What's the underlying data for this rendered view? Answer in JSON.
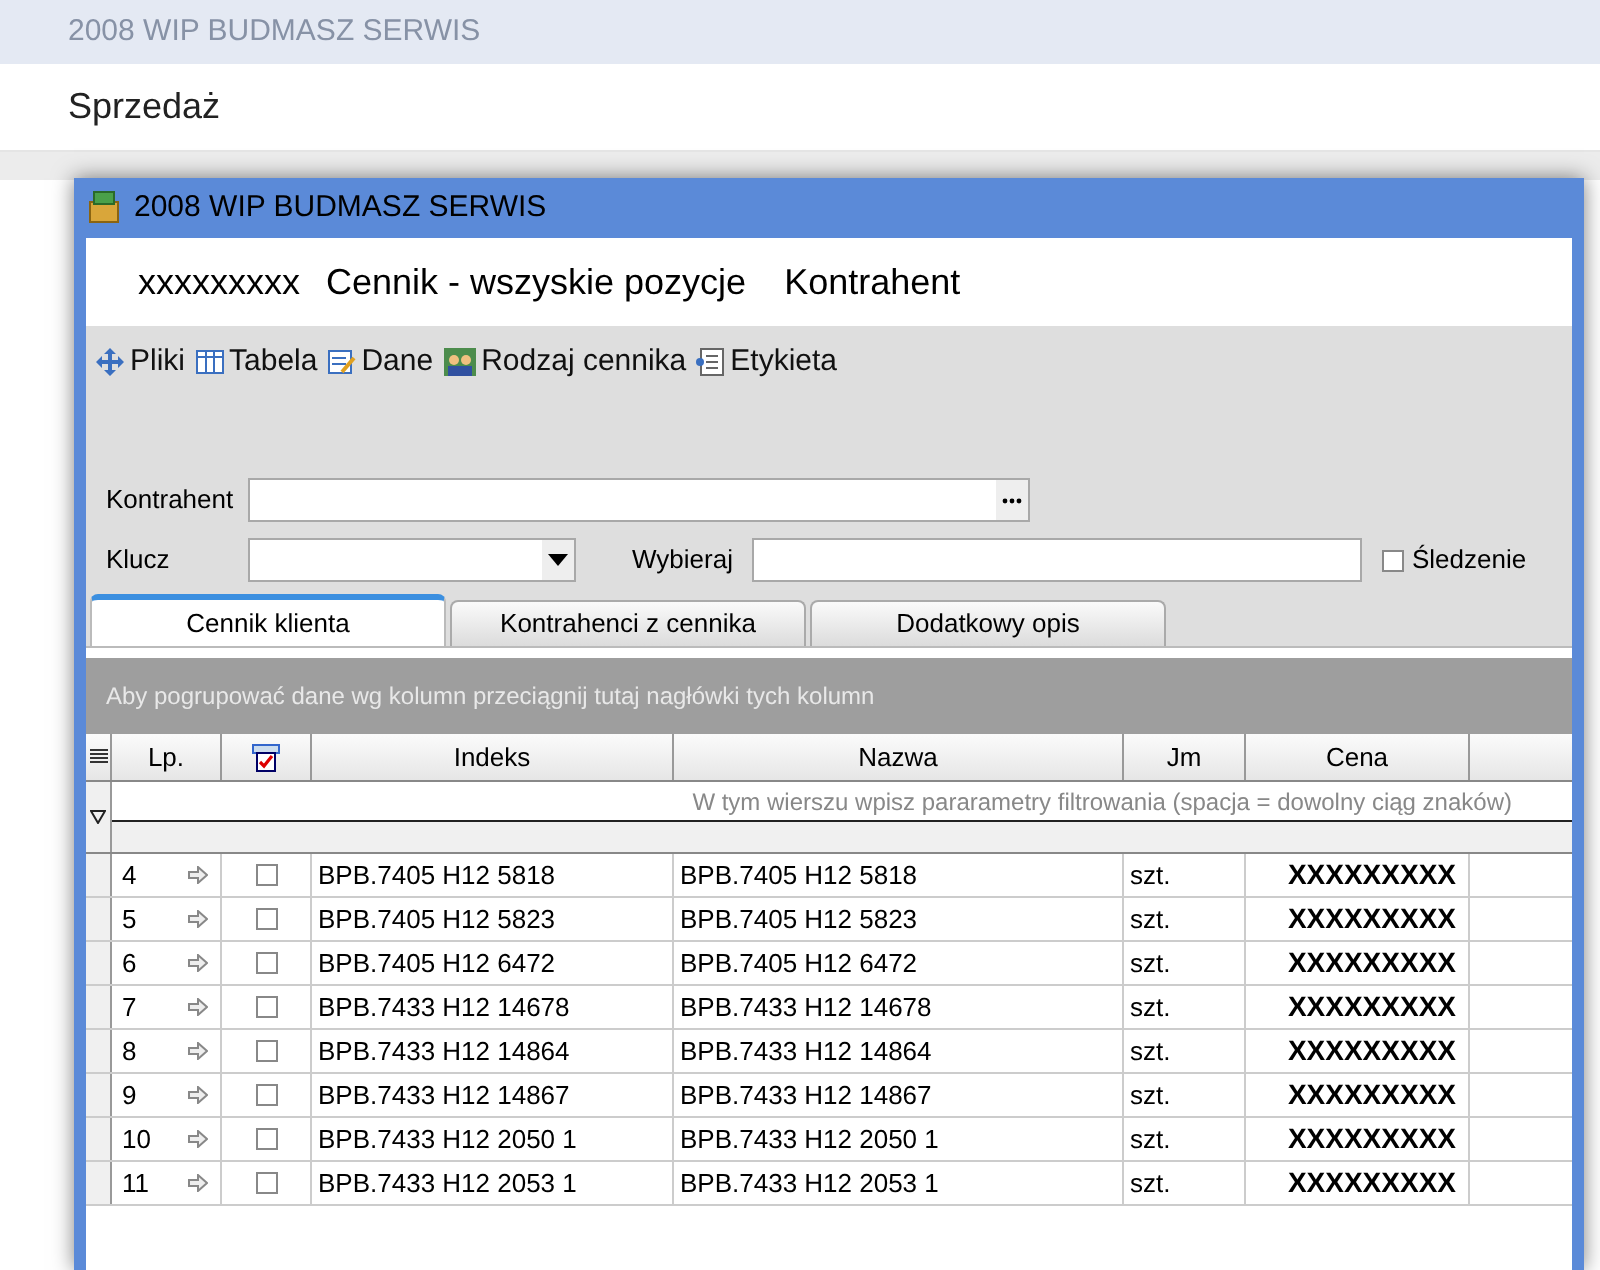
{
  "background_window": {
    "title": "2008 WIP BUDMASZ SERWIS",
    "section": "Sprzedaż"
  },
  "window": {
    "title": "2008 WIP BUDMASZ SERWIS"
  },
  "header": {
    "code": "xxxxxxxxx",
    "title": "Cennik - wszyskie pozycje",
    "subtitle": "Kontrahent"
  },
  "toolbar": [
    {
      "label": "Pliki",
      "kind": "files"
    },
    {
      "label": "Tabela",
      "kind": "table"
    },
    {
      "label": "Dane",
      "kind": "data"
    },
    {
      "label": "Rodzaj cennika",
      "kind": "people"
    },
    {
      "label": "Etykieta",
      "kind": "label"
    }
  ],
  "filters": {
    "kontrahent_label": "Kontrahent",
    "klucz_label": "Klucz",
    "wybieraj_label": "Wybieraj",
    "tracking": {
      "label": "Śledzenie",
      "checked": false
    }
  },
  "tabs": [
    {
      "label": "Cennik klienta",
      "selected": true
    },
    {
      "label": "Kontrahenci z cennika",
      "selected": false
    },
    {
      "label": "Dodatkowy opis",
      "selected": false
    }
  ],
  "group_panel": "Aby pogrupować dane wg kolumn przeciągnij tutaj nagłówki tych kolumn",
  "table": {
    "columns": [
      "Lp.",
      "Indeks",
      "Nazwa",
      "Jm",
      "Cena"
    ],
    "filter_hint": "W tym wierszu wpisz pararametry filtrowania (spacja = dowolny ciąg znaków)",
    "rows": [
      {
        "lp": "4",
        "checked": false,
        "indeks": "BPB.7405 H12 5818",
        "nazwa": "BPB.7405 H12 5818",
        "jm": "szt.",
        "cena": "XXXXXXXXX"
      },
      {
        "lp": "5",
        "checked": false,
        "indeks": "BPB.7405 H12 5823",
        "nazwa": "BPB.7405 H12 5823",
        "jm": "szt.",
        "cena": "XXXXXXXXX"
      },
      {
        "lp": "6",
        "checked": false,
        "indeks": "BPB.7405 H12 6472",
        "nazwa": "BPB.7405 H12 6472",
        "jm": "szt.",
        "cena": "XXXXXXXXX"
      },
      {
        "lp": "7",
        "checked": false,
        "indeks": "BPB.7433 H12 14678",
        "nazwa": "BPB.7433 H12 14678",
        "jm": "szt.",
        "cena": "XXXXXXXXX"
      },
      {
        "lp": "8",
        "checked": false,
        "indeks": "BPB.7433 H12 14864",
        "nazwa": "BPB.7433 H12 14864",
        "jm": "szt.",
        "cena": "XXXXXXXXX"
      },
      {
        "lp": "9",
        "checked": false,
        "indeks": "BPB.7433 H12 14867",
        "nazwa": "BPB.7433 H12 14867",
        "jm": "szt.",
        "cena": "XXXXXXXXX"
      },
      {
        "lp": "10",
        "checked": false,
        "indeks": "BPB.7433 H12 2050 1",
        "nazwa": "BPB.7433 H12 2050 1",
        "jm": "szt.",
        "cena": "XXXXXXXXX"
      },
      {
        "lp": "11",
        "checked": false,
        "indeks": "BPB.7433 H12 2053 1",
        "nazwa": "BPB.7433 H12 2053 1",
        "jm": "szt.",
        "cena": "XXXXXXXXX"
      }
    ]
  }
}
